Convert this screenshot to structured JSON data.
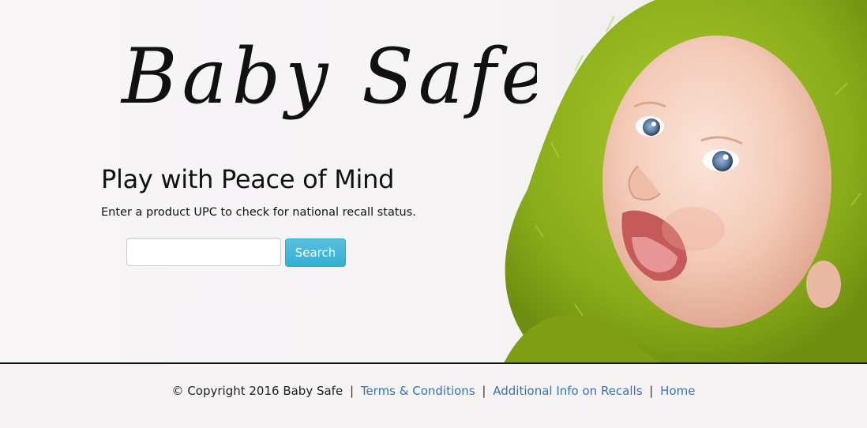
{
  "brand": {
    "logo_text": "Baby Safe"
  },
  "hero": {
    "tagline": "Play with Peace of Mind",
    "instructions": "Enter a product UPC to check for national recall status.",
    "search": {
      "value": "",
      "placeholder": "",
      "button_label": "Search"
    }
  },
  "footer": {
    "copyright": "© Copyright 2016 Baby Safe",
    "separator": "|",
    "links": [
      {
        "label": "Terms & Conditions"
      },
      {
        "label": "Additional Info on Recalls"
      },
      {
        "label": "Home"
      }
    ]
  },
  "colors": {
    "accent_button": "#5bc0de",
    "link": "#3a72b5",
    "towel_green": "#8fb21c"
  },
  "icons": {
    "hero_image": "baby-in-green-towel-image"
  }
}
